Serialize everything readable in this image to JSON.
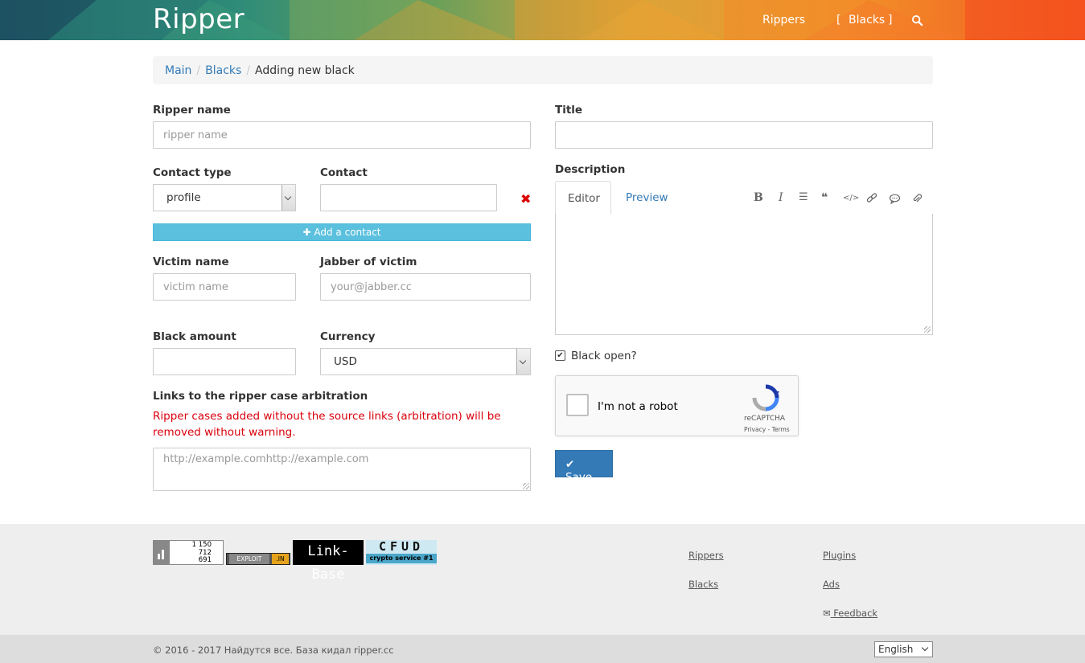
{
  "header": {
    "brand": "Ripper",
    "nav": {
      "rippers": "Rippers",
      "blacks": "Blacks",
      "bracket_open": "[",
      "bracket_close": "]"
    },
    "icon": "search-icon"
  },
  "breadcrumb": {
    "main": "Main",
    "blacks": "Blacks",
    "sep": "/",
    "current": "Adding new black"
  },
  "form": {
    "ripper_name_label": "Ripper name",
    "ripper_name_placeholder": "ripper name",
    "contact_type_label": "Contact type",
    "contact_type_value": "profile",
    "contact_label": "Contact",
    "add_contact_label": "Add a contact",
    "victim_name_label": "Victim name",
    "victim_name_placeholder": "victim name",
    "jabber_label": "Jabber of victim",
    "jabber_placeholder": "your@jabber.cc",
    "amount_label": "Black amount",
    "currency_label": "Currency",
    "currency_value": "USD",
    "links_label": "Links to the ripper case arbitration",
    "links_warning": "Ripper cases added without the source links (arbitration) will be removed without warning.",
    "links_placeholder": "http://example.comhttp://example.com",
    "title_label": "Title",
    "description_label": "Description",
    "tab_editor": "Editor",
    "tab_preview": "Preview",
    "black_open_label": "Black open?",
    "save_label": "Save"
  },
  "captcha": {
    "text": "I'm not a robot",
    "brand": "reCAPTCHA",
    "terms": "Privacy - Terms"
  },
  "counter": {
    "line1": "1 150",
    "line2": "712",
    "line3": "691"
  },
  "badges": {
    "exploit": "EXPLOIT",
    "exploit_suffix": ".IN",
    "linkbase": "Link-Base",
    "cfud": "CFUD",
    "cfud_sub": "crypto service #1"
  },
  "footer": {
    "rippers": "Rippers",
    "blacks": "Blacks",
    "plugins": "Plugins",
    "ads": "Ads",
    "feedback": "Feedback",
    "copyright": "© 2016 - 2017 Найдутся все. База кидал ripper.cc",
    "language": "English"
  },
  "colors": {
    "link": "#337ab7",
    "info": "#5bc0de",
    "danger": "#d9000d",
    "primary": "#337ab7"
  }
}
